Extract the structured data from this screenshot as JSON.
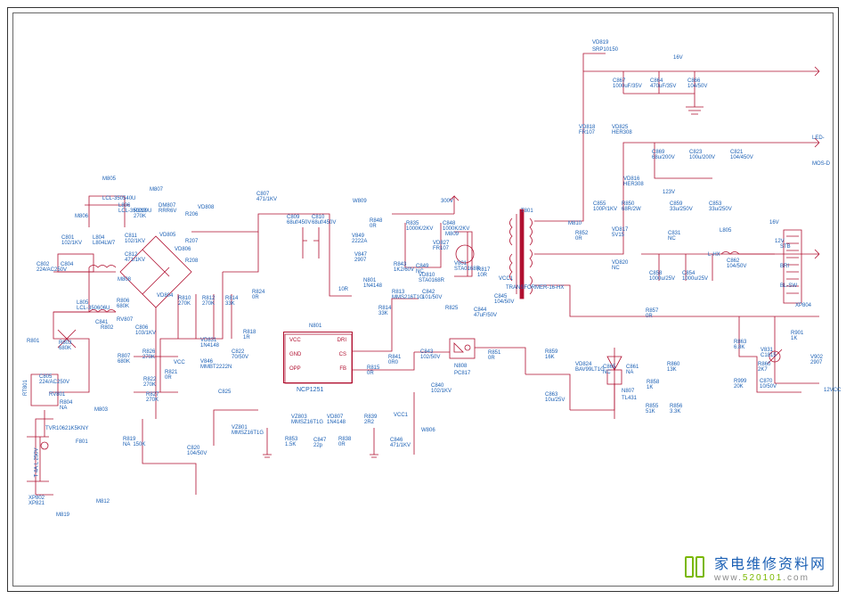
{
  "watermark": {
    "chinese": "家电维修资料网",
    "url_pre": "www.",
    "url_mid": "520101",
    "url_post": ".com"
  },
  "ic": {
    "n801_name": "N801",
    "n801_part": "NCP1251",
    "n808_name": "N808",
    "n808_part": "PC817",
    "n807_name": "N807",
    "n807_part": "TL431",
    "pin_vcc": "VCC",
    "pin_gnd": "GND",
    "pin_opp": "OPP",
    "pin_dri": "DRI",
    "pin_cs": "CS",
    "pin_fb": "FB"
  },
  "rails": {
    "v300": "300V",
    "v16": "16V",
    "v12": "12V",
    "vled": "LED-",
    "vmos": "MOS-D",
    "v123": "123V",
    "vcc1": "VCC1",
    "gnd": "0R",
    "v12vcc": "12VCC",
    "bl_sw": "BL-SW",
    "bri": "BRI",
    "sts": "STB"
  },
  "parts": {
    "vd819": "VD819",
    "srp10150": "SRP10150",
    "c867": "C867\n1000uF/35V",
    "c864": "C864\n470uF/35V",
    "c866": "C866\n104/50V",
    "vd818": "VD818\nFR107",
    "vd825": "VD825\nHER308",
    "c869": "C869\n68u/200V",
    "c823": "C823\n100u/200V",
    "c821": "C821\n104/450V",
    "vd816": "VD816\nHER308",
    "c855": "C855\n100P/1KV",
    "r850": "R850\n68R/2W",
    "c859": "C859\n33u/250V",
    "c853": "C853\n33u/250V",
    "m810": "M810",
    "vd817": "VD817\n5V15",
    "vd820": "VD820\nNC",
    "c858": "C858\n1000u/25V",
    "c854": "C854\n1000u/25V",
    "c862": "C862\n104/50V",
    "r852": "R852\n0R",
    "r857": "R857\n0R",
    "c831": "C831\nNC",
    "l805": "L805",
    "lhx": "L-HX",
    "vd824": "VD824\nBAV99LT1G",
    "c805_b": "C865\nNC",
    "c861": "C861\nNA",
    "r860": "R860\n13K",
    "r858": "R858\n1K",
    "r855": "R855\n51K",
    "r856": "R856\n3.3K",
    "r859": "R859\n16K",
    "c863": "C863\n10u/25V",
    "r863": "R863\n6.8K",
    "v831": "V831\nC1815",
    "r999": "R999\n20K",
    "r860b": "R860\n2K7",
    "c870": "C870\n10/50V",
    "r901": "R901\n1K",
    "v902": "V902\n2907",
    "xp804": "XP804",
    "t801": "T801",
    "txfmr": "TRANSFORMER-16-HX",
    "m805": "M805",
    "m807": "M807",
    "m806": "M806",
    "dm807": "DM807\nRRR6V",
    "vd808": "VD808",
    "c807": "C807\n471/1KV",
    "c809": "C809\n68uf/450V",
    "c810": "C810\n68uf/450V",
    "w809": "W809",
    "r848": "R848\n0R",
    "v849": "V849\n2222A",
    "v847": "V847\n2907",
    "r835": "R835\n1000K/2KV",
    "c848": "C848\n1000K/2KV",
    "m809": "M809",
    "vd805": "VD805",
    "c811": "C811\n102/1KV",
    "vd806": "VD806",
    "r206": "R206",
    "r207": "R207",
    "c812": "C812\n471/1KV",
    "r208": "R208",
    "r843": "R843\n1K2/60V",
    "c849": "C849\nNC",
    "vd810": "VD810\nSTA0168R",
    "vd827": "VD827\nFR107",
    "v801": "V801\nSTA0168R",
    "r817": "R817\n10R",
    "c845": "C845\n104/50V",
    "c842": "C842\n101/50V",
    "r813": "R813\nMMS216T1G",
    "r825": "R825",
    "c844": "C844\n47uF/50V",
    "r814": "R814\n33K",
    "r812": "R812\n270K",
    "r810": "R810\n270K",
    "r810b": "R810\n270K",
    "r806": "R806\n680K",
    "c806": "C806\n103/1KV",
    "r807": "RV807",
    "vd804": "VD804",
    "l806": "L806\nLCL-350209U",
    "l805b": "L805\nLCL-350606U",
    "c801": "C801\n102/1KV",
    "c804": "C804",
    "c802": "C802\n224/AC250V",
    "c805": "C805\n224/AC250V",
    "r801": "R801",
    "r802": "R802",
    "rv801": "RV801",
    "c841": "C841",
    "m808": "M808",
    "l804": "L804\nL804LW7",
    "lcl": "LCL-350540U",
    "r803": "R803\n680K",
    "m803": "M803",
    "rt801": "RT801",
    "r804": "R804\nNA",
    "tvr": "TVR10621K5KNY",
    "f801": "F801",
    "t4": "T 4A.L 250V",
    "xp802": "XP802\nXP821",
    "m819": "M819",
    "m812": "M812",
    "r819": "R819\nNA  150K",
    "c820": "C820\n104/50V",
    "r824": "R824\n0R",
    "r821": "R821\n0R",
    "vcc": "VCC",
    "r826": "R826\n270K",
    "r822": "R822\n270K",
    "r818": "R818\n1R",
    "vd831": "VD831\n1N4148",
    "v846": "V846\nMMBT2222N",
    "c822": "C822\n70/50V",
    "r827": "R827\n270K",
    "c825": "C825",
    "vz801": "VZ801\nMMSZ16T1G",
    "vz803": "VZ803\nMMSZ16T1G",
    "r853": "R853\n1.5K",
    "c847": "C847\n22p",
    "vd807": "VD807\n1N4148",
    "r839": "R839\n2R2",
    "r838": "R838\n0R",
    "c846": "C846\n471/1KV",
    "w806": "W806",
    "r841": "R841\n0R0",
    "n801r": "N801\n1N4148",
    "n801r2": "10R",
    "r815": "R815\n0R",
    "c843": "C843\n102/50V",
    "r851": "R851\n0R",
    "c840": "C840\n102/1KV",
    "r807b": "R807\n680K"
  }
}
